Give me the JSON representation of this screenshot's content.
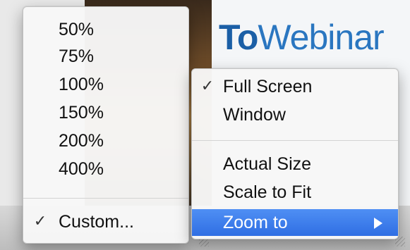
{
  "background": {
    "brand_bold": "To",
    "brand_thin": "Webinar"
  },
  "zoom_menu": {
    "items": [
      {
        "label": "50%"
      },
      {
        "label": "75%"
      },
      {
        "label": "100%"
      },
      {
        "label": "150%"
      },
      {
        "label": "200%"
      },
      {
        "label": "400%"
      }
    ],
    "custom": {
      "label": "Custom...",
      "checked": true,
      "check_glyph": "✓"
    }
  },
  "view_menu": {
    "items": [
      {
        "label": "Full Screen",
        "checked": true,
        "check_glyph": "✓"
      },
      {
        "label": "Window",
        "checked": false
      }
    ],
    "items2": [
      {
        "label": "Actual Size"
      },
      {
        "label": "Scale to Fit"
      },
      {
        "label": "Zoom to",
        "highlighted": true,
        "has_submenu": true
      }
    ]
  },
  "colors": {
    "highlight": "#2f6ee3",
    "brand": "#1b5fa6",
    "menu_bg": "#f7f7f7"
  },
  "icons": {
    "check": "checkmark-icon",
    "submenu": "submenu-arrow-icon"
  }
}
